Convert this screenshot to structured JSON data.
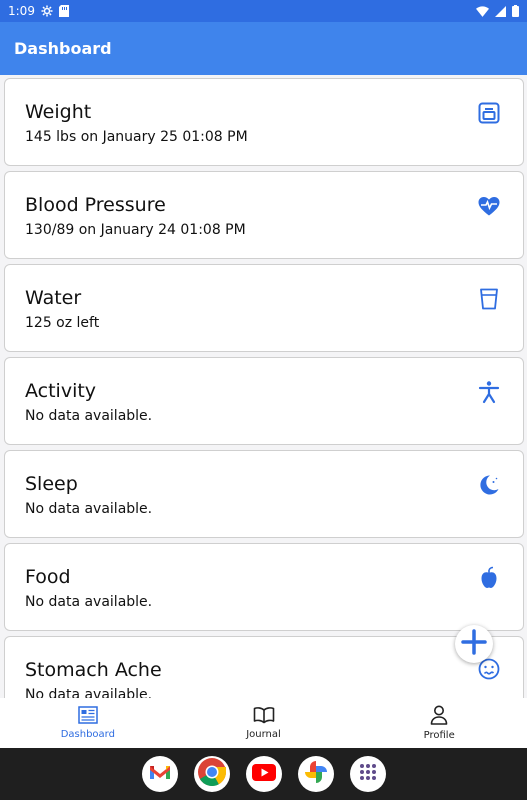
{
  "status_bar": {
    "time": "1:09"
  },
  "app_bar": {
    "title": "Dashboard"
  },
  "cards": [
    {
      "title": "Weight",
      "subtitle": "145 lbs on January 25  01:08 PM",
      "icon": "scale-icon"
    },
    {
      "title": "Blood Pressure",
      "subtitle": "130/89 on January 24 01:08 PM",
      "icon": "heart-pulse-icon"
    },
    {
      "title": "Water",
      "subtitle": "125  oz left",
      "icon": "cup-icon"
    },
    {
      "title": "Activity",
      "subtitle": "No data available.",
      "icon": "person-icon"
    },
    {
      "title": "Sleep",
      "subtitle": "No data available.",
      "icon": "moon-icon"
    },
    {
      "title": "Food",
      "subtitle": "No data available.",
      "icon": "apple-icon"
    },
    {
      "title": "Stomach Ache",
      "subtitle": "No data available.",
      "icon": "sick-face-icon"
    }
  ],
  "bottom_nav": [
    {
      "label": "Dashboard",
      "icon": "dashboard-icon",
      "active": true
    },
    {
      "label": "Journal",
      "icon": "book-icon",
      "active": false
    },
    {
      "label": "Profile",
      "icon": "person-outline-icon",
      "active": false
    }
  ],
  "dock": [
    "gmail-icon",
    "chrome-icon",
    "youtube-icon",
    "photos-icon",
    "app-drawer-icon"
  ],
  "colors": {
    "accent": "#3f84ec",
    "status_bar": "#2f6de1",
    "icon_blue": "#2f6de1"
  }
}
